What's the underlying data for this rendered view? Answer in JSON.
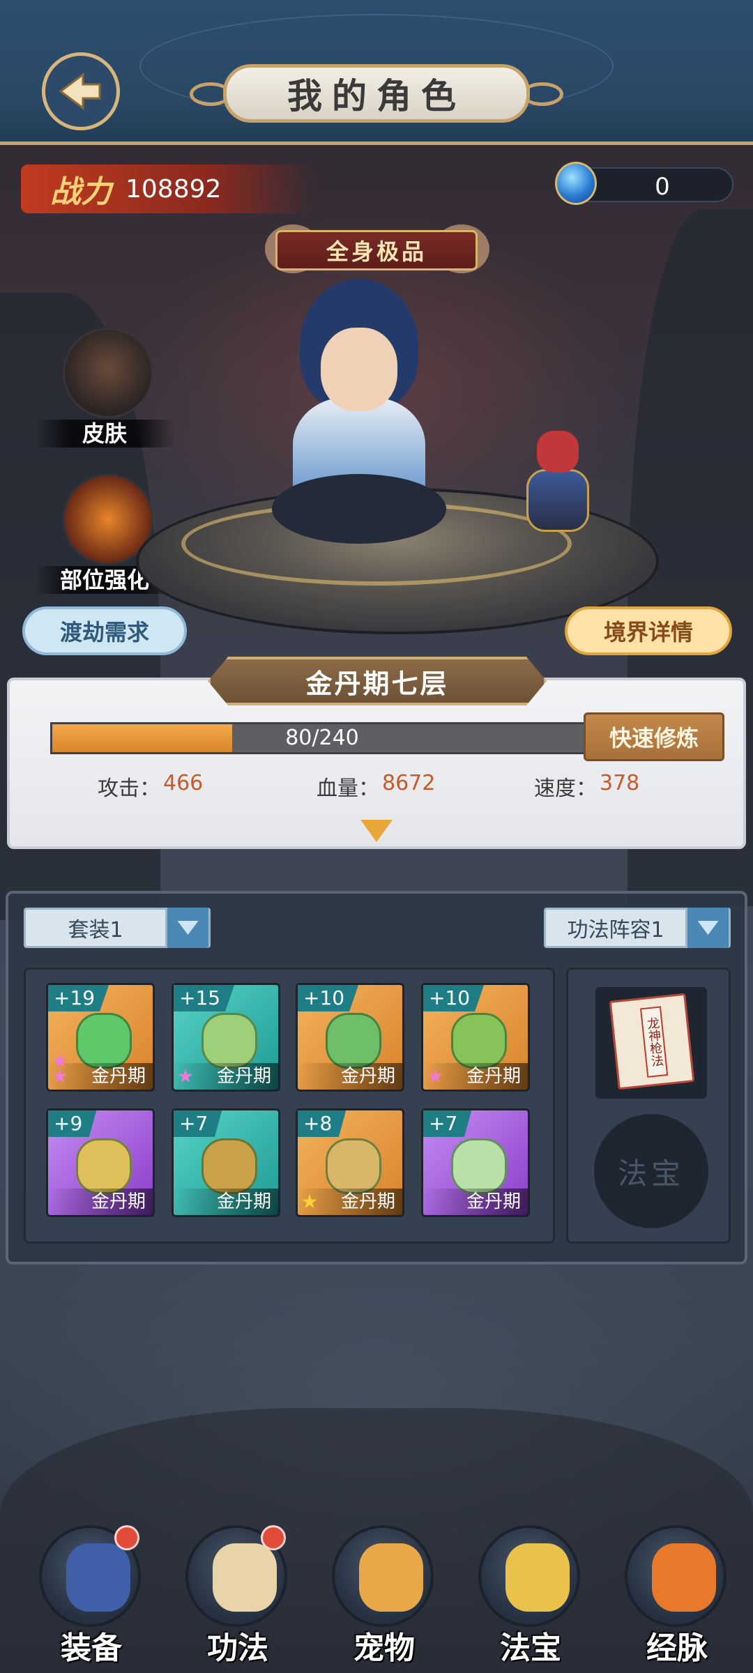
{
  "header": {
    "title": "我的角色"
  },
  "power": {
    "label": "战力",
    "value": "108892"
  },
  "currency": {
    "icon": "blue-orb-icon",
    "value": "0"
  },
  "badge": {
    "label": "全身极品"
  },
  "side_buttons": [
    {
      "label": "皮肤",
      "icon": "skin-hat-icon"
    },
    {
      "label": "部位强化",
      "icon": "lantern-icon"
    }
  ],
  "actions": {
    "tribulation": "渡劫需求",
    "realm_detail": "境界详情"
  },
  "realm": {
    "title": "金丹期七层",
    "progress": {
      "current": 80,
      "max": 240,
      "text": "80/240"
    },
    "train_button": "快速修炼",
    "stats": [
      {
        "label": "攻击：",
        "value": "466"
      },
      {
        "label": "血量：",
        "value": "8672"
      },
      {
        "label": "速度：",
        "value": "378"
      }
    ]
  },
  "equipment": {
    "set_select": "套装1",
    "technique_select": "功法阵容1",
    "slots": [
      {
        "plus": "+19",
        "rank": "金丹期",
        "color": "orange",
        "item": "sword",
        "stars": 2,
        "star_color": "pink"
      },
      {
        "plus": "+15",
        "rank": "金丹期",
        "color": "teal",
        "item": "armor",
        "stars": 1,
        "star_color": "pink"
      },
      {
        "plus": "+10",
        "rank": "金丹期",
        "color": "orange",
        "item": "helmet",
        "stars": 0,
        "star_color": ""
      },
      {
        "plus": "+10",
        "rank": "金丹期",
        "color": "orange",
        "item": "boots",
        "stars": 1,
        "star_color": "pink"
      },
      {
        "plus": "+9",
        "rank": "金丹期",
        "color": "purple",
        "item": "necklace",
        "stars": 0,
        "star_color": ""
      },
      {
        "plus": "+7",
        "rank": "金丹期",
        "color": "teal",
        "item": "bracelet",
        "stars": 0,
        "star_color": ""
      },
      {
        "plus": "+8",
        "rank": "金丹期",
        "color": "orange",
        "item": "ring",
        "stars": 1,
        "star_color": "gold"
      },
      {
        "plus": "+7",
        "rank": "金丹期",
        "color": "purple",
        "item": "jade",
        "stars": 0,
        "star_color": ""
      }
    ],
    "technique_book": "龙神枪法",
    "treasure_slot": "法宝"
  },
  "bottom_nav": [
    {
      "label": "装备",
      "icon": "armor-icon",
      "dot": true
    },
    {
      "label": "功法",
      "icon": "scroll-icon",
      "dot": true
    },
    {
      "label": "宠物",
      "icon": "pet-dragon-icon",
      "dot": false
    },
    {
      "label": "法宝",
      "icon": "golden-bell-icon",
      "dot": false
    },
    {
      "label": "经脉",
      "icon": "meridian-icon",
      "dot": false
    }
  ],
  "colors": {
    "header": "#2a4866",
    "gold_border": "#c7a36a",
    "progress_fill": "#e8962f",
    "stat_value": "#c45b2a",
    "notification": "#e24a3a"
  }
}
